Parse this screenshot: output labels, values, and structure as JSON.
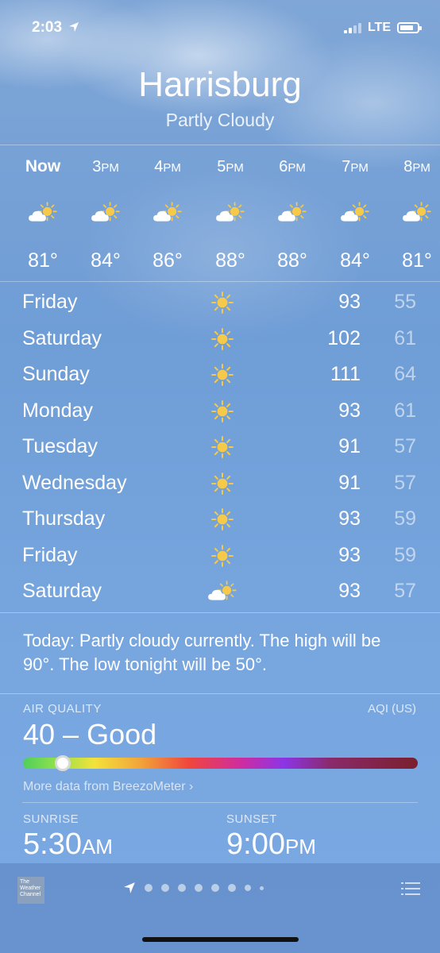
{
  "status": {
    "time": "2:03",
    "network": "LTE"
  },
  "header": {
    "city": "Harrisburg",
    "condition": "Partly Cloudy"
  },
  "hourly": [
    {
      "time": "Now",
      "hr": "",
      "ap": "",
      "icon": "partly-cloudy-icon",
      "temp": "81°"
    },
    {
      "time": "",
      "hr": "3",
      "ap": "PM",
      "icon": "partly-cloudy-icon",
      "temp": "84°"
    },
    {
      "time": "",
      "hr": "4",
      "ap": "PM",
      "icon": "partly-cloudy-icon",
      "temp": "86°"
    },
    {
      "time": "",
      "hr": "5",
      "ap": "PM",
      "icon": "partly-cloudy-icon",
      "temp": "88°"
    },
    {
      "time": "",
      "hr": "6",
      "ap": "PM",
      "icon": "partly-cloudy-icon",
      "temp": "88°"
    },
    {
      "time": "",
      "hr": "7",
      "ap": "PM",
      "icon": "partly-cloudy-icon",
      "temp": "84°"
    },
    {
      "time": "",
      "hr": "8",
      "ap": "PM",
      "icon": "partly-cloudy-icon",
      "temp": "81°"
    }
  ],
  "daily": [
    {
      "day": "Friday",
      "icon": "sun-icon",
      "hi": "93",
      "lo": "55"
    },
    {
      "day": "Saturday",
      "icon": "sun-icon",
      "hi": "102",
      "lo": "61"
    },
    {
      "day": "Sunday",
      "icon": "sun-icon",
      "hi": "111",
      "lo": "64"
    },
    {
      "day": "Monday",
      "icon": "sun-icon",
      "hi": "93",
      "lo": "61"
    },
    {
      "day": "Tuesday",
      "icon": "sun-icon",
      "hi": "91",
      "lo": "57"
    },
    {
      "day": "Wednesday",
      "icon": "sun-icon",
      "hi": "91",
      "lo": "57"
    },
    {
      "day": "Thursday",
      "icon": "sun-icon",
      "hi": "93",
      "lo": "59"
    },
    {
      "day": "Friday",
      "icon": "sun-icon",
      "hi": "93",
      "lo": "59"
    },
    {
      "day": "Saturday",
      "icon": "partly-cloudy-icon",
      "hi": "93",
      "lo": "57"
    }
  ],
  "summary": "Today: Partly cloudy currently. The high will be 90°. The low tonight will be 50°.",
  "air_quality": {
    "label": "AIR QUALITY",
    "unit": "AQI (US)",
    "value": "40 – Good",
    "level_fraction": 0.1,
    "more": "More data from BreezoMeter ›"
  },
  "sun": {
    "sunrise_label": "SUNRISE",
    "sunrise_time": "5:30",
    "sunrise_ap": "AM",
    "sunset_label": "SUNSET",
    "sunset_time": "9:00",
    "sunset_ap": "PM"
  },
  "toolbar": {
    "logo_text": "The Weather Channel",
    "page_count": 9,
    "current_page": 0
  },
  "colors": {
    "sun": "#f7c948",
    "cloud": "#ffffff"
  }
}
